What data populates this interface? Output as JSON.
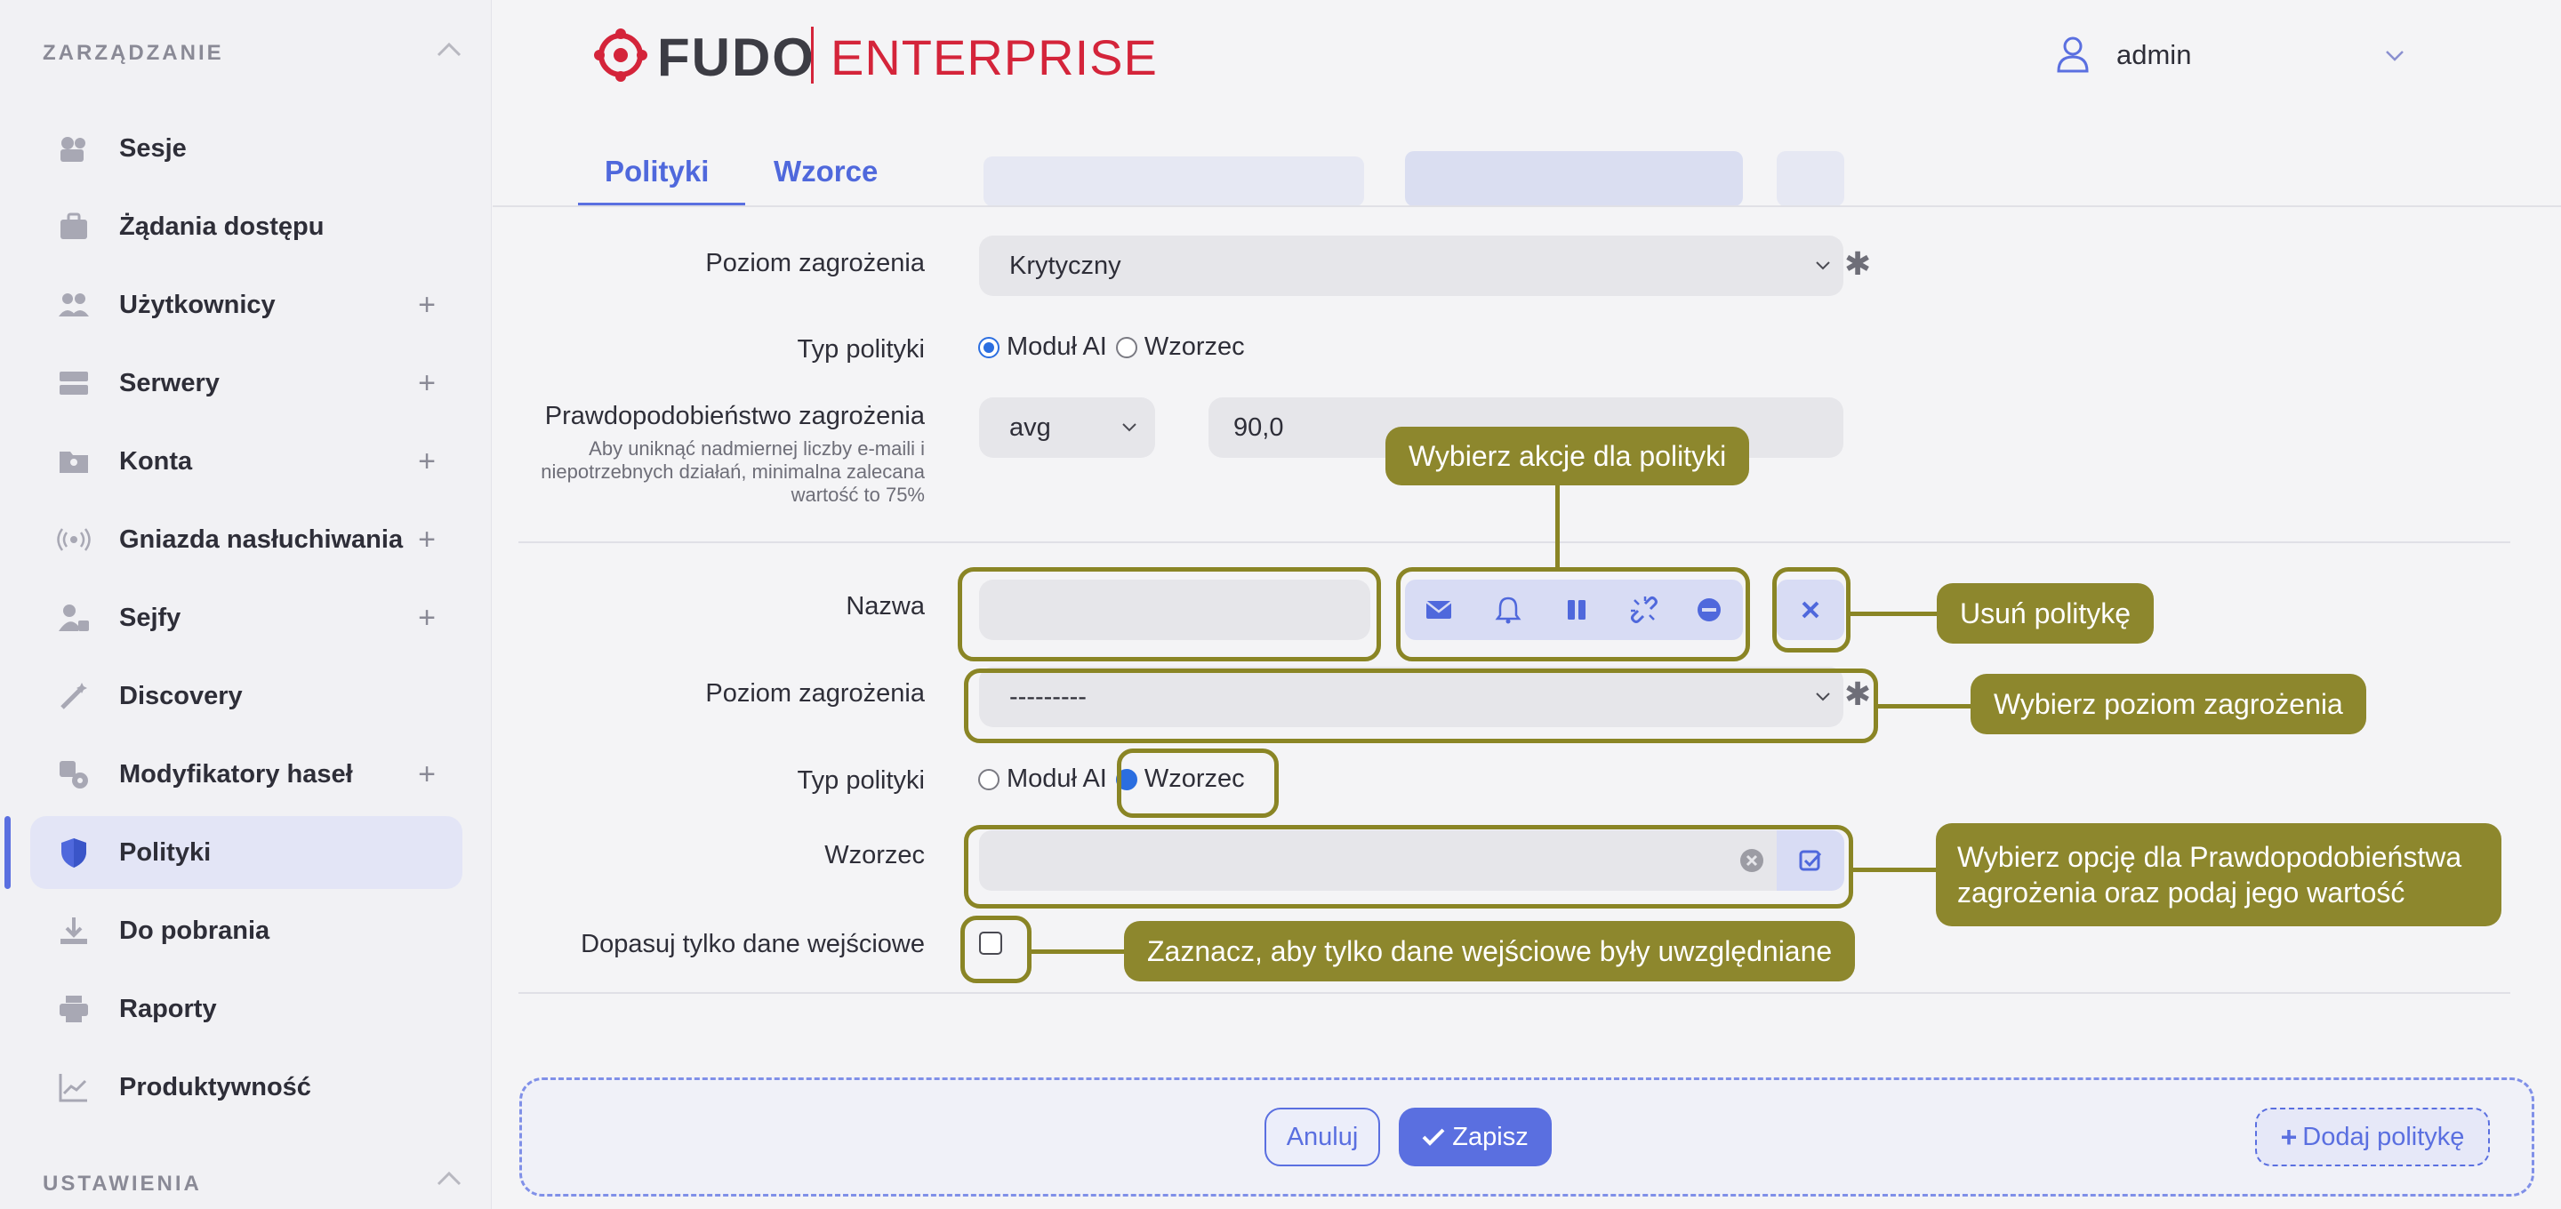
{
  "sidebar": {
    "section_management": "ZARZĄDZANIE",
    "section_settings": "USTAWIENIA",
    "items": [
      {
        "label": "Sesje",
        "plus": ""
      },
      {
        "label": "Żądania dostępu",
        "plus": ""
      },
      {
        "label": "Użytkownicy",
        "plus": "+"
      },
      {
        "label": "Serwery",
        "plus": "+"
      },
      {
        "label": "Konta",
        "plus": "+"
      },
      {
        "label": "Gniazda nasłuchiwania",
        "plus": "+"
      },
      {
        "label": "Sejfy",
        "plus": "+"
      },
      {
        "label": "Discovery",
        "plus": ""
      },
      {
        "label": "Modyfikatory haseł",
        "plus": "+"
      },
      {
        "label": "Polityki",
        "plus": ""
      },
      {
        "label": "Do pobrania",
        "plus": ""
      },
      {
        "label": "Raporty",
        "plus": ""
      },
      {
        "label": "Produktywność",
        "plus": ""
      }
    ],
    "active_item": "Polityki"
  },
  "header": {
    "logo_fudo": "FUDO",
    "logo_enterprise": "ENTERPRISE",
    "user": "admin"
  },
  "tabs": [
    {
      "label": "Polityki",
      "active": true
    },
    {
      "label": "Wzorce",
      "active": false
    }
  ],
  "policy1": {
    "threat_level_label": "Poziom zagrożenia",
    "threat_level_value": "Krytyczny",
    "required_mark": "✱",
    "policy_type_label": "Typ polityki",
    "type_ai": "Moduł AI",
    "type_pattern": "Wzorzec",
    "selected_type": "Moduł AI",
    "probability_label": "Prawdopodobieństwo zagrożenia",
    "probability_hint": "Aby uniknąć nadmiernej liczby e-maili i niepotrzebnych działań, minimalna zalecana wartość to 75%",
    "probability_operator": "avg",
    "probability_value": "90,0"
  },
  "policy2": {
    "name_label": "Nazwa",
    "name_value": "",
    "threat_level_label": "Poziom zagrożenia",
    "threat_level_value": "---------",
    "required_mark": "✱",
    "policy_type_label": "Typ polityki",
    "type_ai": "Moduł AI",
    "type_pattern": "Wzorzec",
    "selected_type": "Wzorzec",
    "pattern_label": "Wzorzec",
    "pattern_value": "",
    "match_input_label": "Dopasuj tylko dane wejściowe",
    "match_input_checked": false,
    "actions": [
      "envelope-icon",
      "bell-icon",
      "pause-icon",
      "unlink-icon",
      "minus-circle-icon"
    ]
  },
  "callouts": {
    "actions": "Wybierz akcje dla polityki",
    "delete": "Usuń politykę",
    "threat": "Wybierz poziom zagrożenia",
    "probability": "Wybierz opcję dla Prawdopodobieństwa zagrożenia oraz podaj jego wartość",
    "input_only": "Zaznacz, aby tylko dane wejściowe były uwzględniane"
  },
  "footer": {
    "cancel": "Anuluj",
    "save": "Zapisz",
    "add_policy": "Dodaj politykę"
  },
  "colors": {
    "accent": "#5a6fe0",
    "callout": "#8d872d",
    "brand_red": "#d4243a"
  }
}
